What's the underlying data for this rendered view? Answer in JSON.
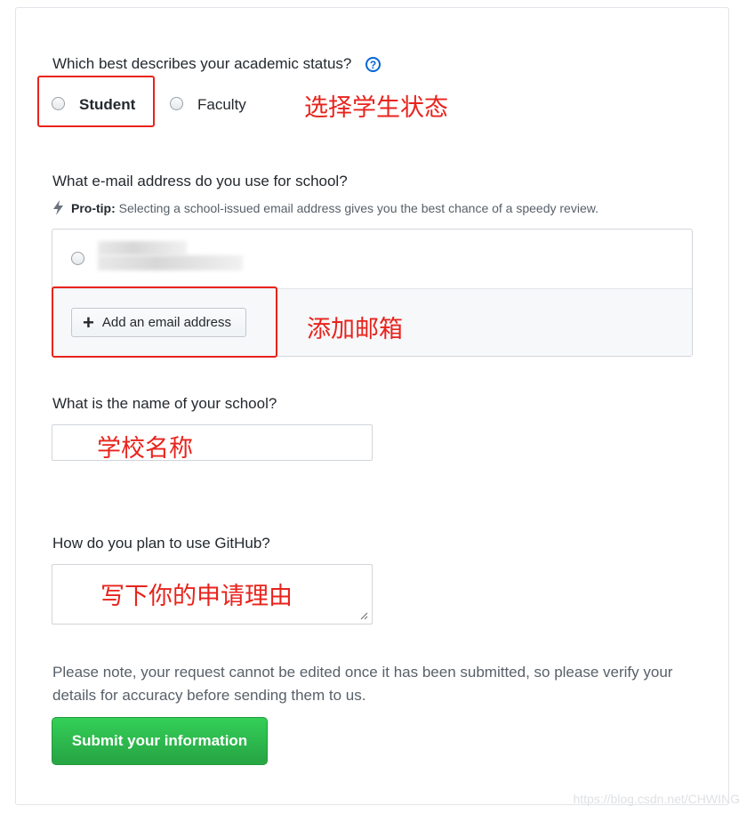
{
  "status": {
    "question": "Which best describes your academic status?",
    "help_icon": "question-circle-icon",
    "options": [
      "Student",
      "Faculty"
    ],
    "annotation": "选择学生状态"
  },
  "email": {
    "question": "What e-mail address do you use for school?",
    "tip_icon": "lightning-icon",
    "tip_bold": "Pro-tip:",
    "tip_text": "Selecting a school-issued email address gives you the best chance of a speedy review.",
    "add_button_icon": "plus-icon",
    "add_button": "Add an email address",
    "annotation": "添加邮箱"
  },
  "school": {
    "question": "What is the name of your school?",
    "annotation": "学校名称"
  },
  "usage": {
    "question": "How do you plan to use GitHub?",
    "annotation": "写下你的申请理由"
  },
  "note": "Please note, your request cannot be edited once it has been submitted, so please verify your details for accuracy before sending them to us.",
  "submit": "Submit your information",
  "watermark": "https://blog.csdn.net/CHWING",
  "colors": {
    "annotation_red": "#e8231c",
    "link_blue": "#0366d6",
    "submit_green": "#28a745"
  }
}
